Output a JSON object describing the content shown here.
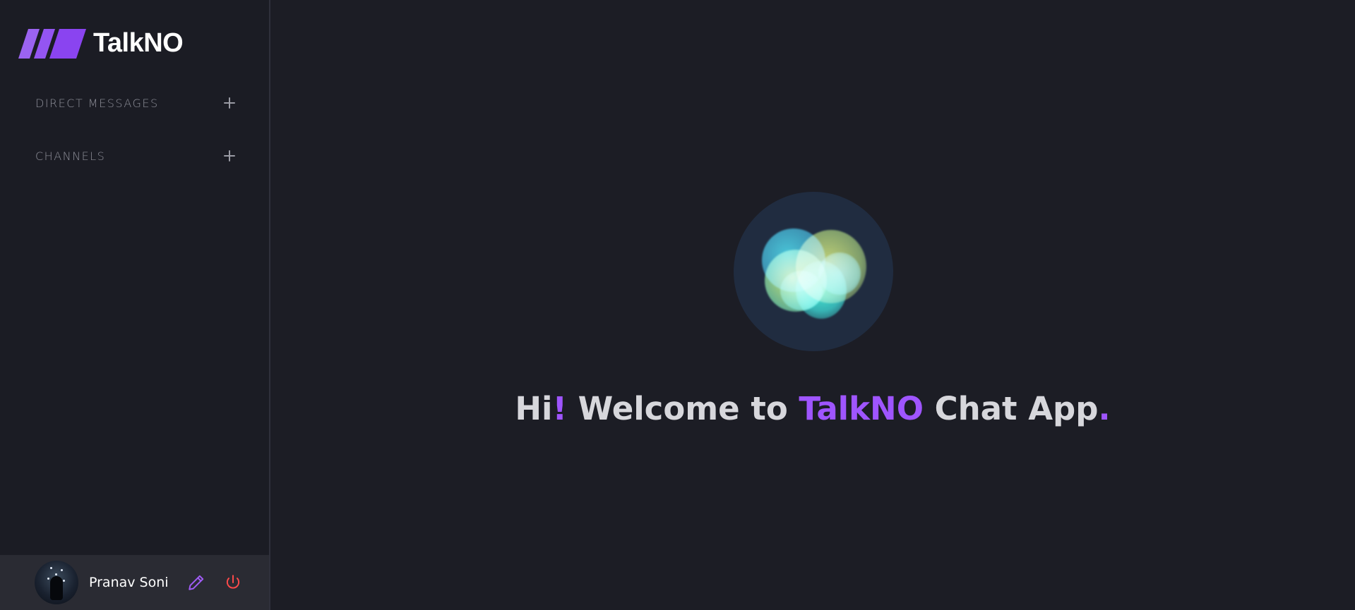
{
  "app": {
    "name": "TalkNO",
    "accent_color": "#9f55ff",
    "background_color": "#1c1d25"
  },
  "sidebar": {
    "sections": [
      {
        "label": "DIRECT MESSAGES",
        "add_icon": "plus-icon"
      },
      {
        "label": "CHANNELS",
        "add_icon": "plus-icon"
      }
    ]
  },
  "profile": {
    "name": "Pranav Soni",
    "edit_icon": "pencil-icon",
    "logout_icon": "power-icon",
    "logout_color": "#ff4a4a"
  },
  "welcome": {
    "greeting": "Hi",
    "exclamation": "!",
    "text": " Welcome to ",
    "brand": "TalkNO",
    "suffix": " Chat App",
    "period": "."
  }
}
